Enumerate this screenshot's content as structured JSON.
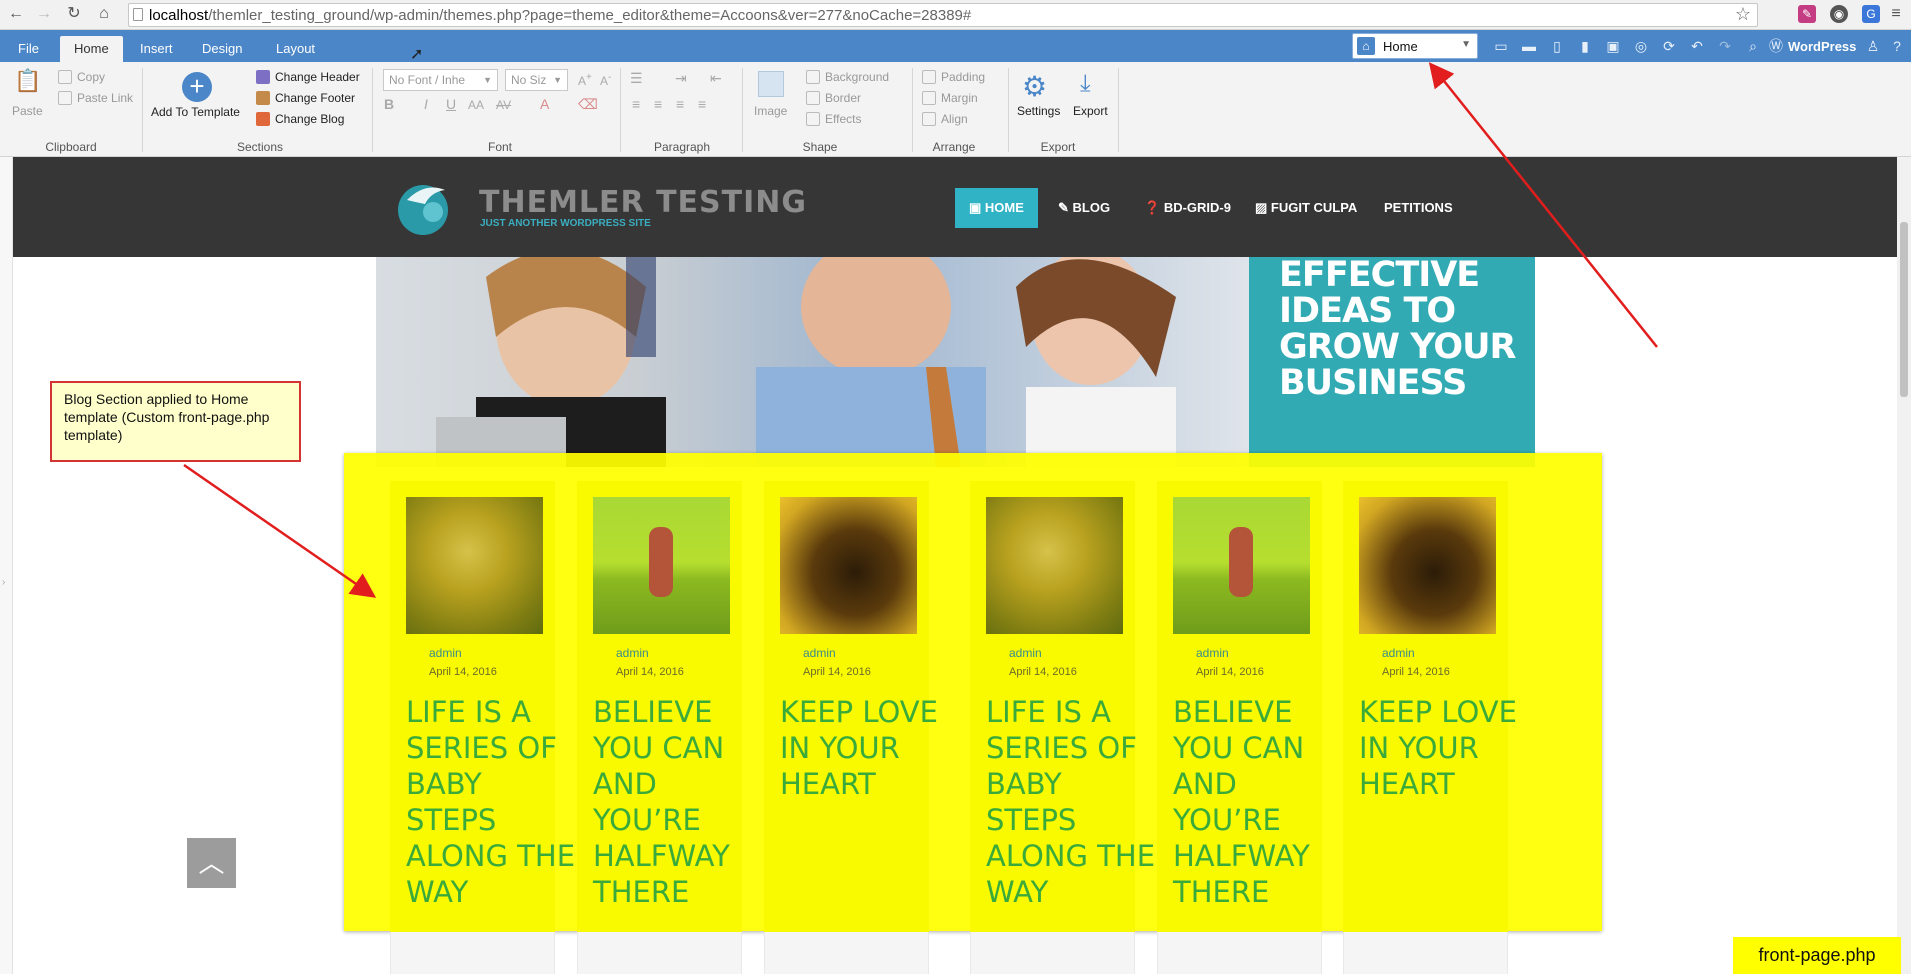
{
  "browser": {
    "url_host": "localhost",
    "url_path": "/themler_testing_ground/wp-admin/themes.php?page=theme_editor&theme=Accoons&ver=277&noCache=28389#"
  },
  "ribbon": {
    "tabs": [
      "File",
      "Home",
      "Insert",
      "Design",
      "Layout"
    ],
    "active_tab": "Home",
    "page_select": "Home",
    "wordpress_label": "WordPress",
    "clipboard": {
      "paste": "Paste",
      "copy": "Copy",
      "paste_link": "Paste Link",
      "group": "Clipboard"
    },
    "sections": {
      "add_to_template": "Add To Template",
      "change_header": "Change Header",
      "change_footer": "Change Footer",
      "change_blog": "Change Blog",
      "group": "Sections"
    },
    "font": {
      "font_select": "No Font / Inhe",
      "size_select": "No Siz",
      "group": "Font"
    },
    "paragraph": {
      "group": "Paragraph"
    },
    "shape": {
      "image": "Image",
      "background": "Background",
      "border": "Border",
      "effects": "Effects",
      "group": "Shape"
    },
    "arrange": {
      "padding": "Padding",
      "margin": "Margin",
      "align": "Align",
      "group": "Arrange"
    },
    "export": {
      "settings": "Settings",
      "export": "Export",
      "group": "Export"
    }
  },
  "site": {
    "brand": "THEMLER TESTING",
    "tagline": "JUST ANOTHER WORDPRESS SITE",
    "nav": [
      "HOME",
      "BLOG",
      "BD-GRID-9",
      "FUGIT CULPA",
      "PETITIONS"
    ],
    "active_nav": "HOME",
    "hero_text": "EFFECTIVE IDEAS TO GROW YOUR BUSINESS"
  },
  "posts": [
    {
      "author": "admin",
      "date": "April 14, 2016",
      "title": "LIFE IS A SERIES OF BABY STEPS ALONG THE WAY"
    },
    {
      "author": "admin",
      "date": "April 14, 2016",
      "title": "BELIEVE YOU CAN AND YOU’RE HALFWAY THERE"
    },
    {
      "author": "admin",
      "date": "April 14, 2016",
      "title": "KEEP LOVE IN YOUR HEART"
    },
    {
      "author": "admin",
      "date": "April 14, 2016",
      "title": "LIFE IS A SERIES OF BABY STEPS ALONG THE WAY"
    },
    {
      "author": "admin",
      "date": "April 14, 2016",
      "title": "BELIEVE YOU CAN AND YOU’RE HALFWAY THERE"
    },
    {
      "author": "admin",
      "date": "April 14, 2016",
      "title": "KEEP LOVE IN YOUR HEART"
    }
  ],
  "annotation": {
    "note": "Blog Section applied to Home template (Custom front-page.php template)",
    "file_label": "front-page.php",
    "arrow_color": "#e11d1d",
    "highlight_color": "#ffff00"
  }
}
